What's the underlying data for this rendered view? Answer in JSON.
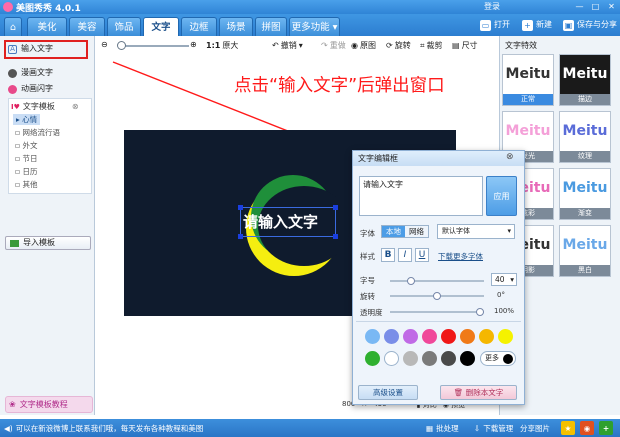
{
  "app": {
    "title": "美图秀秀 4.0.1",
    "login": "登录"
  },
  "tabs": [
    "美化",
    "美容",
    "饰品",
    "文字",
    "边框",
    "场景",
    "拼图"
  ],
  "more_tab": "更多功能",
  "header_buttons": {
    "open": "打开",
    "new": "新建",
    "save": "保存与分享"
  },
  "left_panel": {
    "input_text": "输入文字",
    "comic_text": "漫画文字",
    "animated_text": "动画闪字",
    "template_header": "文字模板",
    "template_nodes": [
      "心情",
      "网络流行语",
      "外文",
      "节日",
      "日历",
      "其他"
    ],
    "import_template": "导入模板",
    "tutorial": "文字模板教程"
  },
  "toolbar": {
    "one_to_one": "1:1",
    "original_size": "原大",
    "undo": "撤销",
    "redo": "重做",
    "original": "原图",
    "rotate": "旋转",
    "crop": "裁剪",
    "size": "尺寸"
  },
  "annotation": "点击“输入文字”后弹出窗口",
  "canvas": {
    "text": "请输入文字",
    "width": "800",
    "height": "450",
    "compare": "对比",
    "preview": "预览"
  },
  "right_panel": {
    "title": "文字特效",
    "effects": [
      {
        "word": "Meitu",
        "label": "正常"
      },
      {
        "word": "Meitu",
        "label": "描边"
      },
      {
        "word": "Meitu",
        "label": "发光"
      },
      {
        "word": "Meitu",
        "label": "纹理"
      },
      {
        "word": "Meitu",
        "label": "炫彩"
      },
      {
        "word": "Meitu",
        "label": "渐变"
      },
      {
        "word": "Meitu",
        "label": "阴影"
      },
      {
        "word": "Meitu",
        "label": "黑白"
      }
    ]
  },
  "dialog": {
    "title": "文字编辑框",
    "text_value": "请输入文字",
    "apply": "应用",
    "font_label": "字体",
    "font_local": "本地",
    "font_web": "网络",
    "font_value": "默认字体",
    "style_label": "样式",
    "style_b": "B",
    "style_i": "I",
    "style_u": "U",
    "download_link": "下载更多字体",
    "size_label": "字号",
    "size_value": "40",
    "size_level": 0.2,
    "rotate_label": "旋转",
    "rotate_value": "0°",
    "rotate_level": 0.5,
    "opacity_label": "透明度",
    "opacity_value": "100%",
    "opacity_level": 1.0,
    "more_colors": "更多",
    "advanced": "高级设置",
    "delete": "删除本文字",
    "colors": [
      "#79b8f4",
      "#7a8ee8",
      "#c06ae6",
      "#f0489a",
      "#f01818",
      "#f07a18",
      "#f5b700",
      "#f5f200",
      "#2fb02f",
      "#ffffff",
      "#b8b8b8",
      "#7a7a7a",
      "#4a4a4a",
      "#000000"
    ]
  },
  "status": {
    "tip": "可以在新浪微博上联系我们哦，每天发布各种教程和美图",
    "batch": "批处理",
    "downloads": "下载管理",
    "share": "分享图片"
  }
}
